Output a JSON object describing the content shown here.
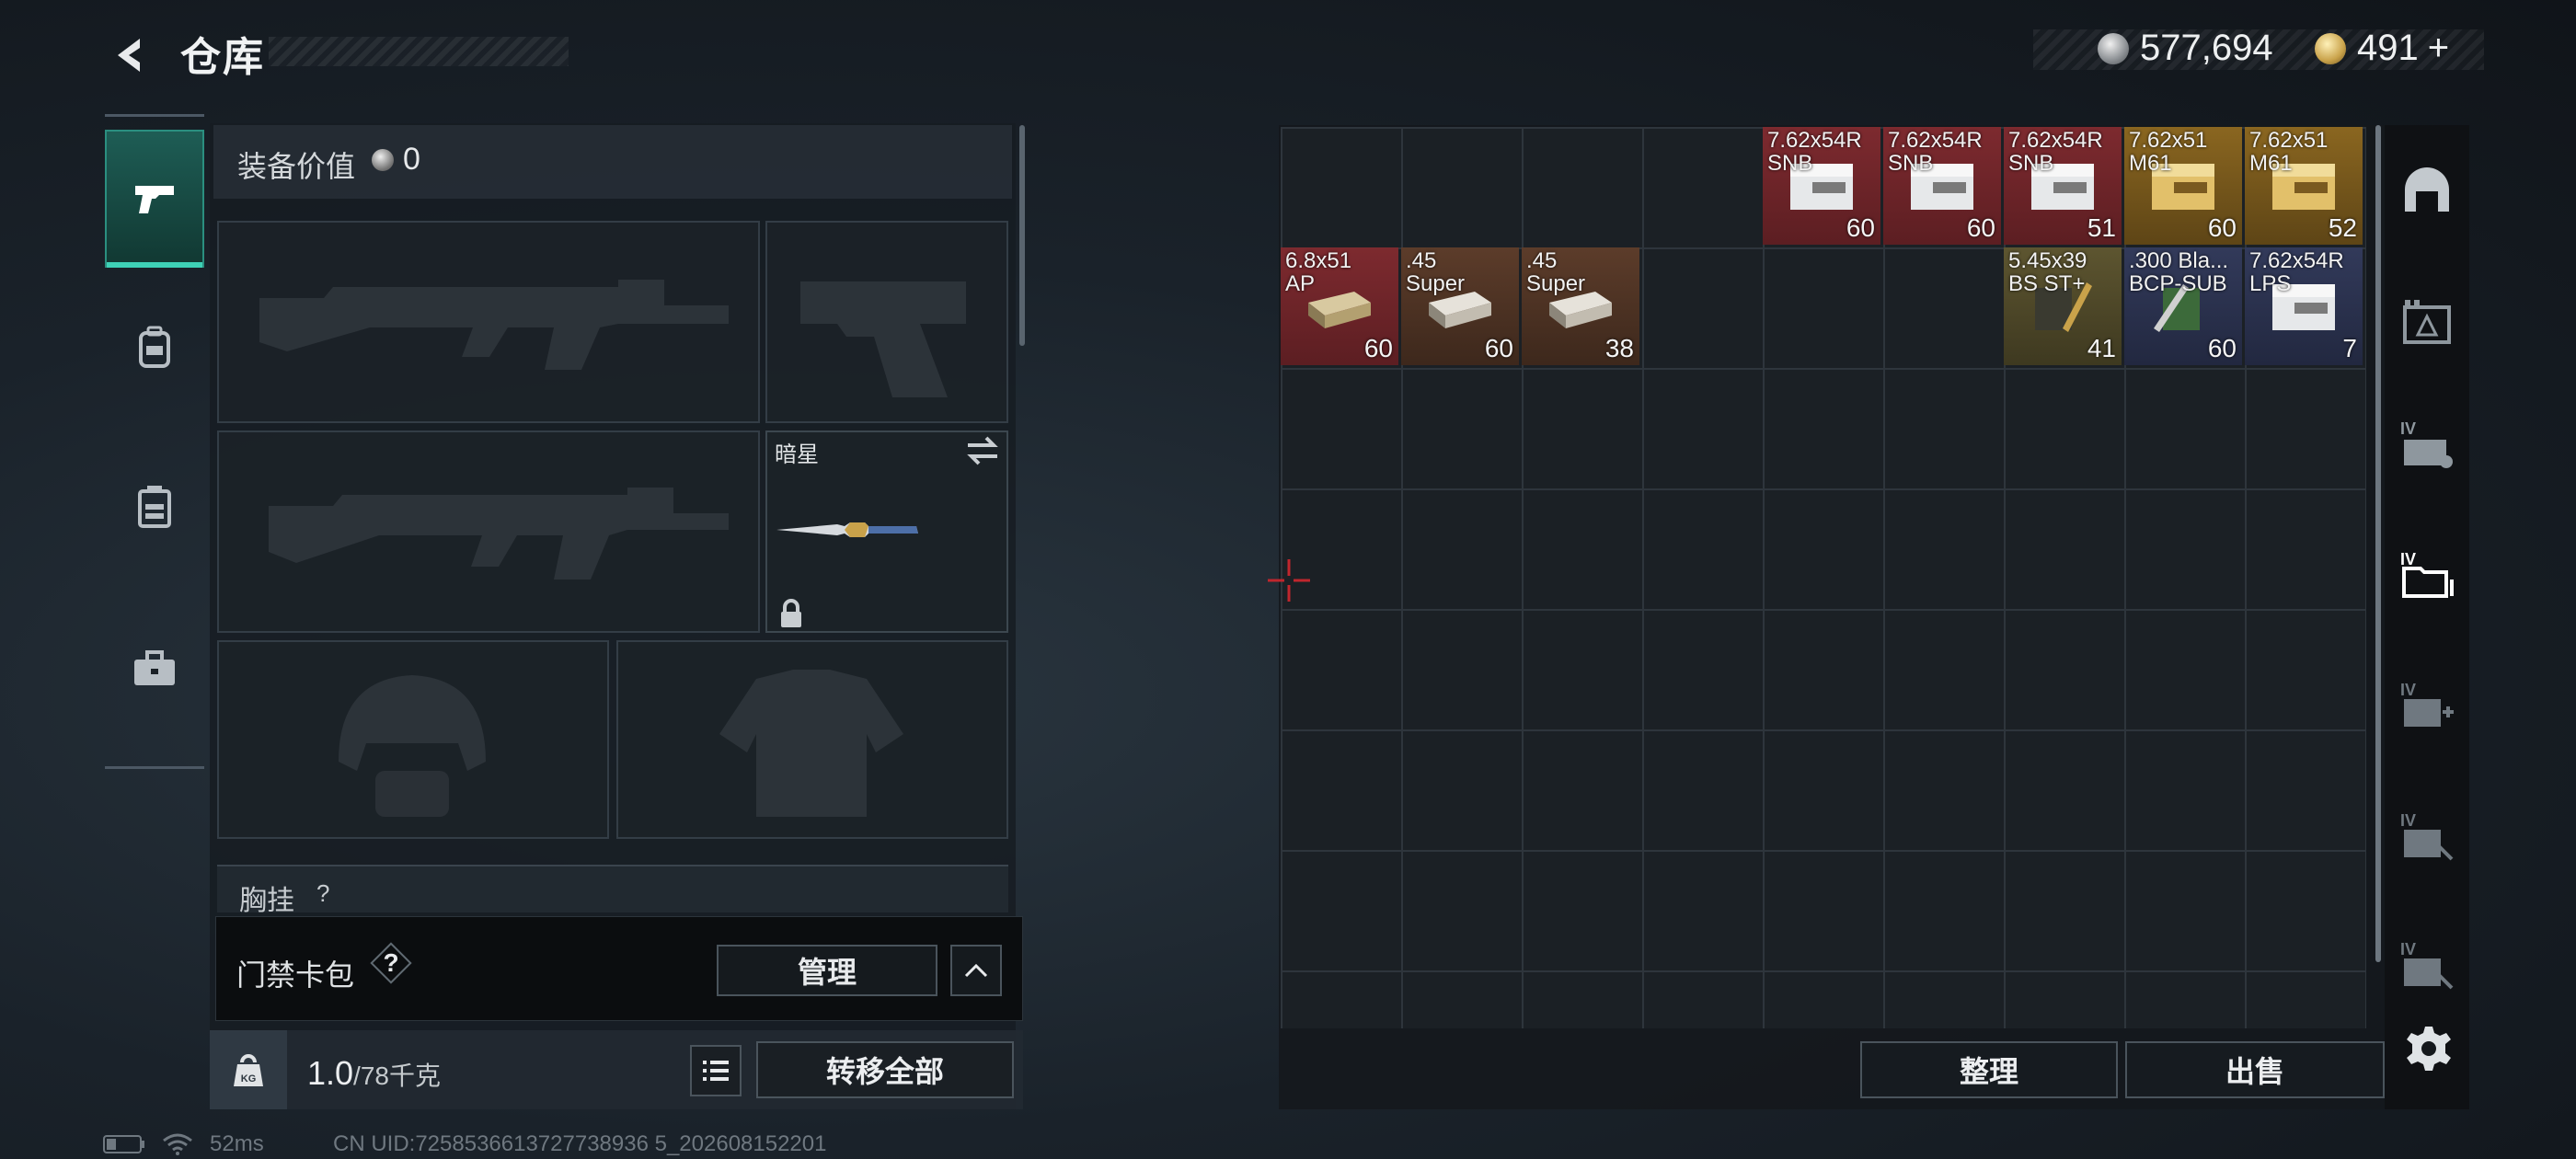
{
  "header": {
    "title": "仓库",
    "silver_amount": "577,694",
    "gold_amount": "491",
    "gold_plus": "+"
  },
  "left_nav": [
    "weapon-tab",
    "backpack-tab",
    "chest-rig-tab",
    "case-tab"
  ],
  "loadout": {
    "equip_value_label": "装备价值",
    "equip_value": "0",
    "knife_name": "暗星",
    "chest_rig_label": "胸挂",
    "chest_rig_help": "?"
  },
  "card_pack": {
    "label": "门禁卡包",
    "help": "?",
    "manage": "管理"
  },
  "weight": {
    "current": "1.0",
    "max": "/78千克",
    "icon_text": "KG"
  },
  "transfer_all": "转移全部",
  "status": {
    "ping": "52ms",
    "uid": "CN UID:7258536613727738936 5_202608152201"
  },
  "stash": {
    "items_row1": [
      {
        "name": "7.62x54R\nSNB",
        "count": "60",
        "rarity": "red"
      },
      {
        "name": "7.62x54R\nSNB",
        "count": "60",
        "rarity": "red"
      },
      {
        "name": "7.62x54R\nSNB",
        "count": "51",
        "rarity": "red"
      },
      {
        "name": "7.62x51\nM61",
        "count": "60",
        "rarity": "gold"
      },
      {
        "name": "7.62x51\nM61",
        "count": "52",
        "rarity": "gold"
      }
    ],
    "items_row2_left": [
      {
        "name": "6.8x51\nAP",
        "count": "60",
        "rarity": "red"
      },
      {
        "name": ".45\nSuper",
        "count": "60",
        "rarity": "brown"
      },
      {
        "name": ".45\nSuper",
        "count": "38",
        "rarity": "brown"
      }
    ],
    "items_row2_right": [
      {
        "name": "5.45x39\nBS ST+",
        "count": "41",
        "rarity": "olive"
      },
      {
        "name": ".300 Bla...\nBCP-SUB",
        "count": "60",
        "rarity": "blue"
      },
      {
        "name": "7.62x54R\nLPS",
        "count": "7",
        "rarity": "blue"
      }
    ],
    "tidy": "整理",
    "sell": "出售"
  },
  "colors": {
    "accent_teal": "#3ed1b6",
    "rarity_red": "#7d2a2f",
    "rarity_gold": "#8a6620",
    "rarity_blue": "#323a5a"
  }
}
